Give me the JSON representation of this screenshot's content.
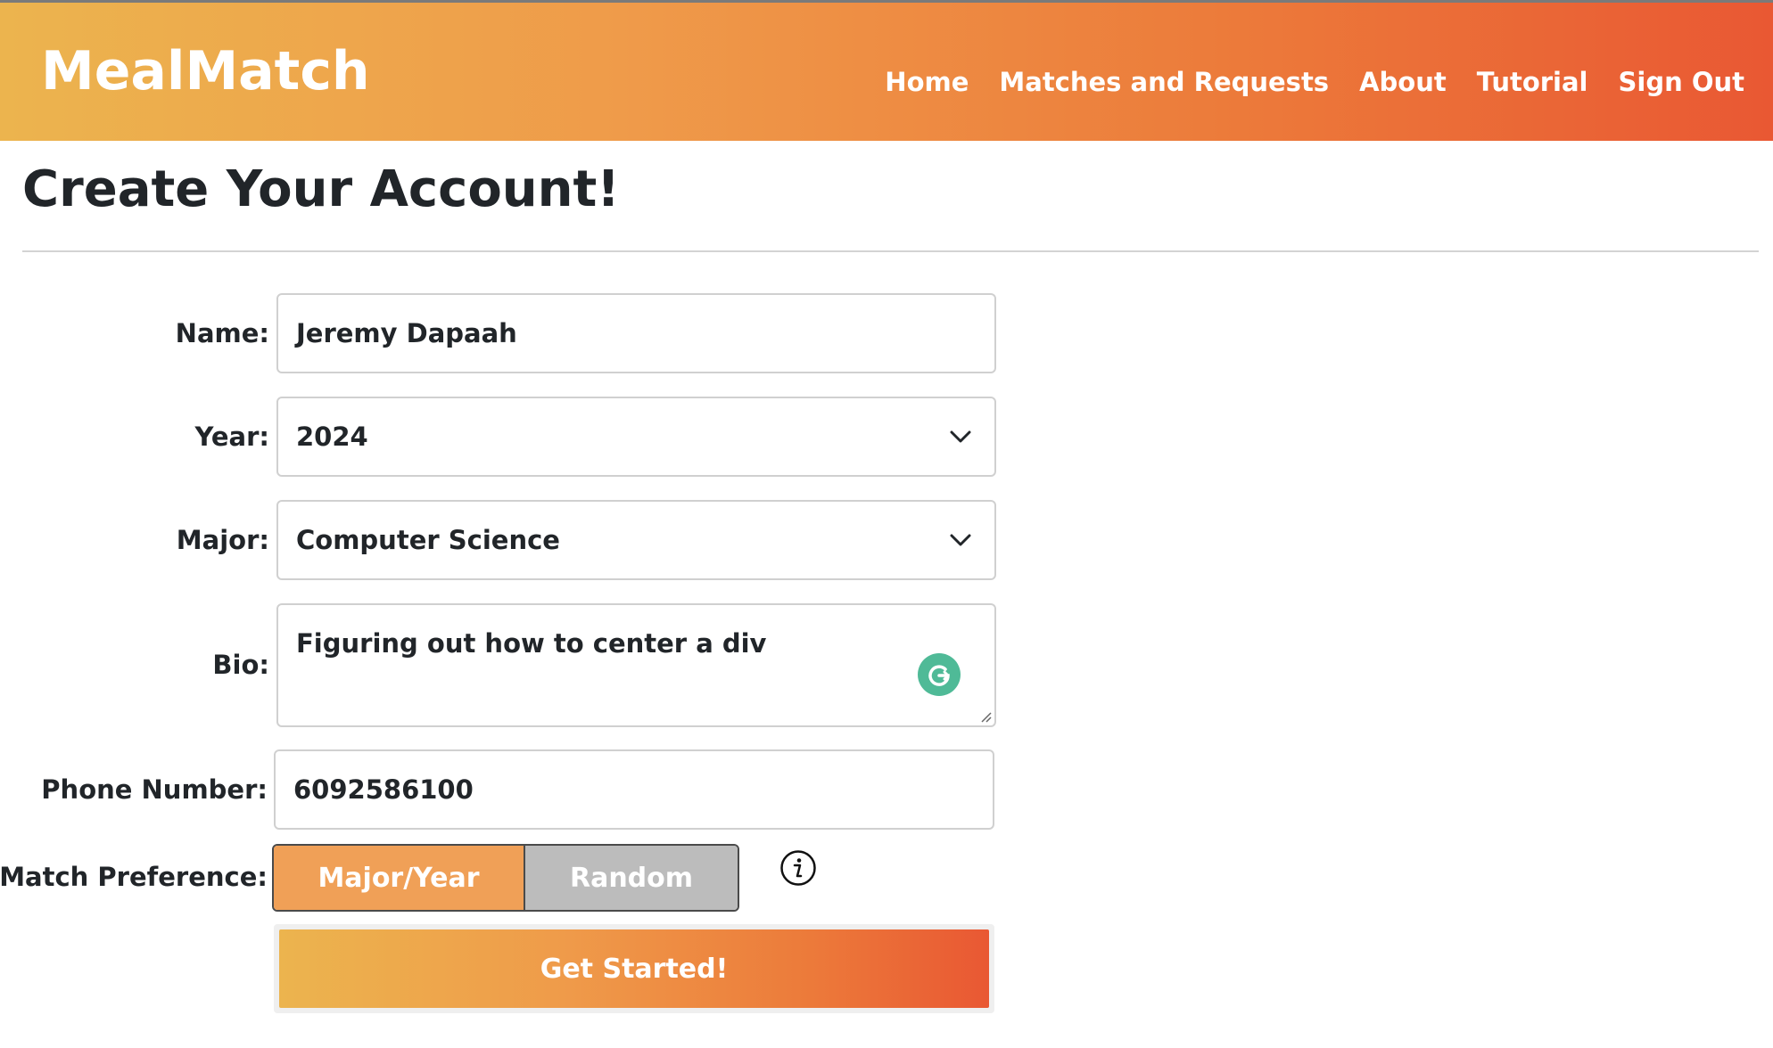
{
  "brand": "MealMatch",
  "nav": {
    "items": [
      "Home",
      "Matches and Requests",
      "About",
      "Tutorial",
      "Sign Out"
    ]
  },
  "page_title": "Create Your Account!",
  "form": {
    "name_label": "Name:",
    "name_value": "Jeremy Dapaah",
    "year_label": "Year:",
    "year_value": "2024",
    "major_label": "Major:",
    "major_value": "Computer Science",
    "bio_label": "Bio:",
    "bio_value": "Figuring out how to center a div",
    "phone_label": "Phone Number:",
    "phone_value": "6092586100",
    "match_pref_label": "Match Preference:",
    "match_pref_options": [
      "Major/Year",
      "Random"
    ],
    "match_pref_selected": "Major/Year",
    "submit_label": "Get Started!"
  },
  "colors": {
    "gradient_start": "#ecb44e",
    "gradient_end": "#e95833",
    "toggle_selected": "#f0a057",
    "toggle_unselected": "#bcbcbc",
    "grammarly_green": "#4fba97"
  },
  "icons": {
    "year_dropdown": "chevron-down-icon",
    "major_dropdown": "chevron-down-icon",
    "bio_assistant": "grammarly-icon",
    "match_info": "info-icon",
    "bio_resize": "resize-handle-icon"
  }
}
